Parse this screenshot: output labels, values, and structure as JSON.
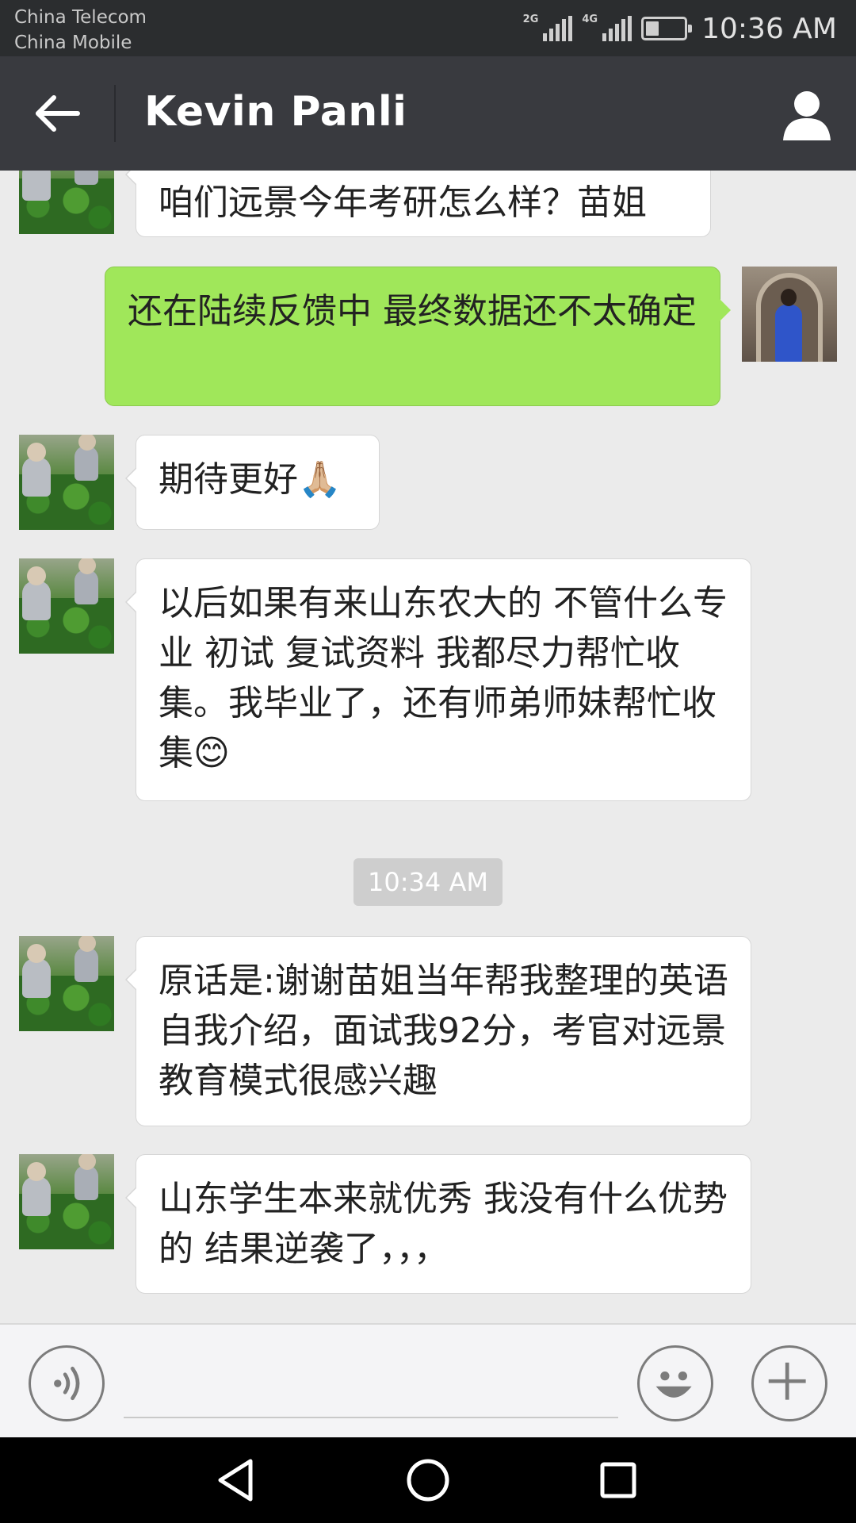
{
  "status_bar": {
    "carrier1": "China Telecom",
    "carrier2": "China Mobile",
    "net1": "2G",
    "net2": "4G",
    "battery_level": 0.35,
    "time": "10:36 AM"
  },
  "header": {
    "title": "Kevin Panli",
    "back_icon": "arrow-left-icon",
    "profile_icon": "person-icon"
  },
  "messages": [
    {
      "side": "left",
      "text": "咱们远景今年考研怎么样？苗姐"
    },
    {
      "side": "right",
      "text": "还在陆续反馈中 最终数据还不太确定"
    },
    {
      "side": "left",
      "text": "期待更好",
      "emoji": "🙏🏼"
    },
    {
      "side": "left",
      "text": "以后如果有来山东农大的 不管什么专业 初试 复试资料 我都尽力帮忙收集。我毕业了，还有师弟师妹帮忙收集",
      "emoji": "😊"
    },
    {
      "side": "left",
      "text": "原话是:谢谢苗姐当年帮我整理的英语自我介绍，面试我92分，考官对远景教育模式很感兴趣"
    },
    {
      "side": "left",
      "text": "山东学生本来就优秀 我没有什么优势的 结果逆袭了，，，"
    }
  ],
  "time_separator": "10:34 AM",
  "input_bar": {
    "voice_icon": "voice-icon",
    "emoji_icon": "smiley-icon",
    "plus_icon": "plus-icon",
    "input_value": ""
  },
  "nav_bar": {
    "back_icon": "triangle-back-icon",
    "home_icon": "circle-home-icon",
    "recent_icon": "square-recent-icon"
  },
  "colors": {
    "status_bar": "#2b2d2f",
    "title_bar": "#393a3f",
    "chat_bg": "#ebebeb",
    "sent_bubble": "#a0e75a",
    "received_bubble": "#ffffff"
  }
}
